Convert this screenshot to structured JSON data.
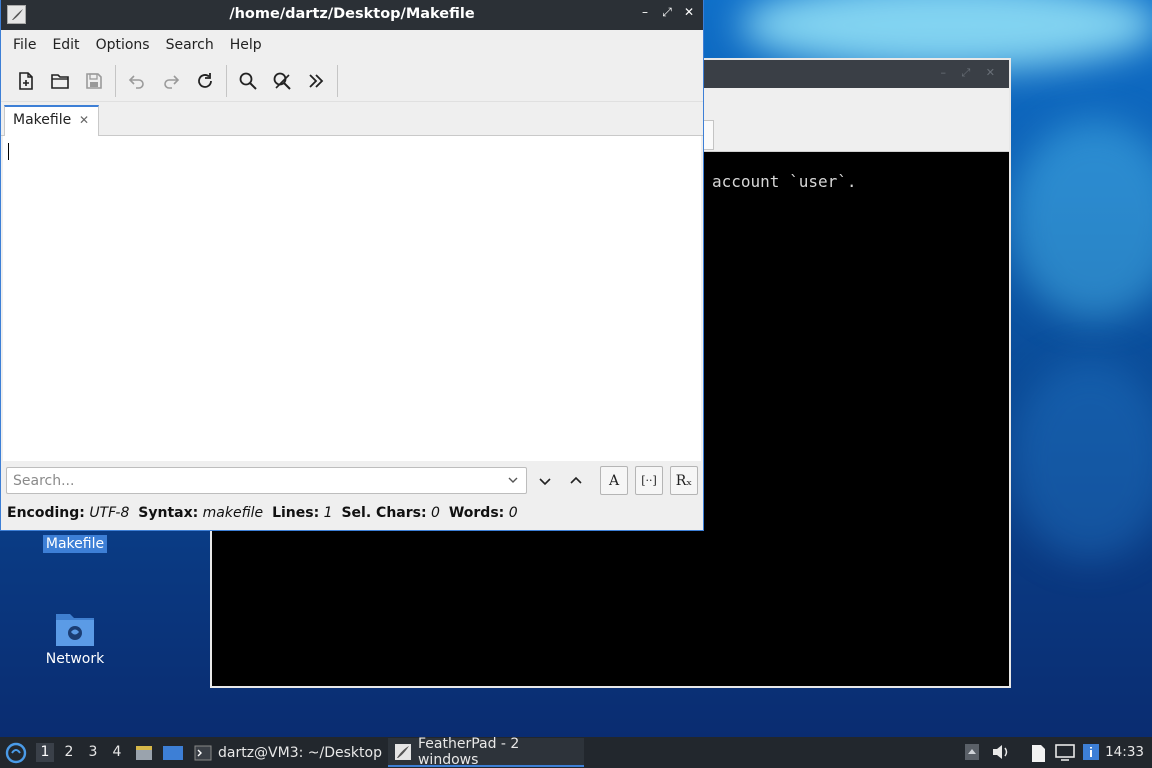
{
  "desktop": {
    "icons": [
      {
        "label": "Makefile"
      },
      {
        "label": "Network"
      }
    ]
  },
  "terminal": {
    "visible_text": "account `user`."
  },
  "featherpad": {
    "title": "/home/dartz/Desktop/Makefile",
    "menu": [
      "File",
      "Edit",
      "Options",
      "Search",
      "Help"
    ],
    "tab_label": "Makefile",
    "search_placeholder": "Search...",
    "search_buttons": {
      "match_case": "A",
      "whole_word": "[··]",
      "regex": "Rₓ"
    },
    "status": {
      "encoding_label": "Encoding:",
      "encoding": "UTF-8",
      "syntax_label": "Syntax:",
      "syntax": "makefile",
      "lines_label": "Lines:",
      "lines": "1",
      "sel_label": "Sel. Chars:",
      "sel": "0",
      "words_label": "Words:",
      "words": "0"
    }
  },
  "taskbar": {
    "workspaces": [
      "1",
      "2",
      "3",
      "4"
    ],
    "tasks": [
      {
        "label": "dartz@VM3: ~/Desktop"
      },
      {
        "label": "FeatherPad - 2 windows"
      }
    ],
    "clock": "14:33"
  }
}
